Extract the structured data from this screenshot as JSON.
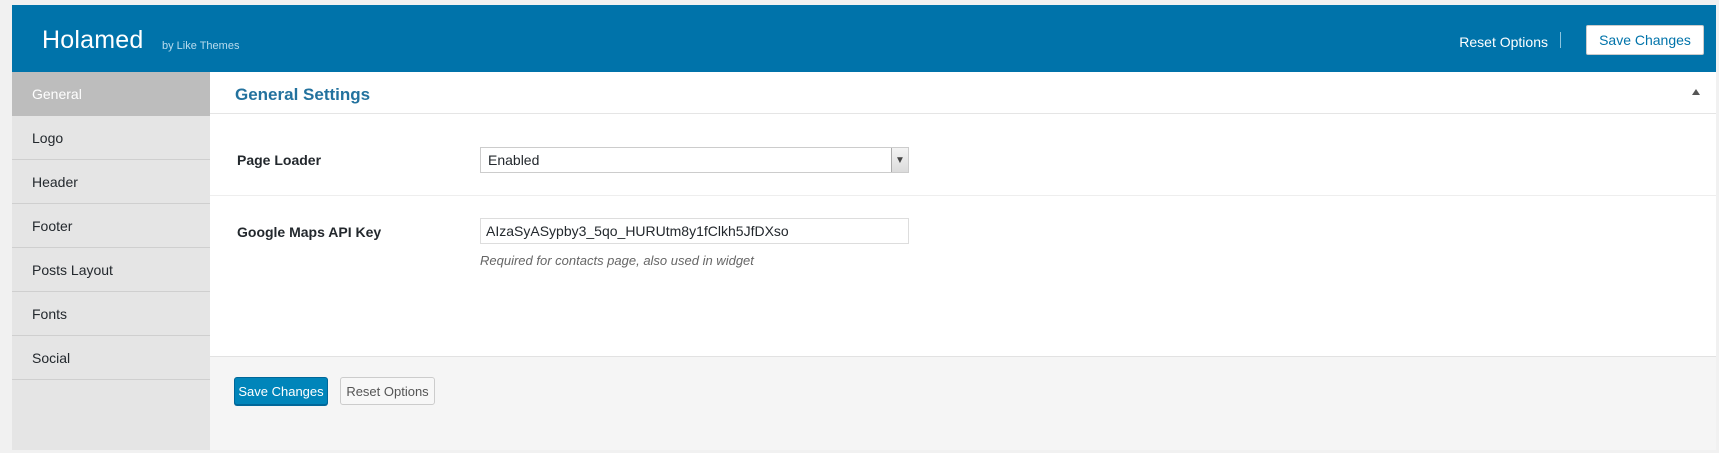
{
  "header": {
    "title": "Holamed",
    "subtitle": "by Like Themes",
    "reset_label": "Reset Options",
    "save_label": "Save Changes",
    "bg_color": "#0073aa"
  },
  "sidebar": {
    "items": [
      {
        "label": "General",
        "active": true
      },
      {
        "label": "Logo",
        "active": false
      },
      {
        "label": "Header",
        "active": false
      },
      {
        "label": "Footer",
        "active": false
      },
      {
        "label": "Posts Layout",
        "active": false
      },
      {
        "label": "Fonts",
        "active": false
      },
      {
        "label": "Social",
        "active": false
      }
    ]
  },
  "section": {
    "title": "General Settings",
    "collapse_icon": "triangle-up-icon"
  },
  "fields": {
    "page_loader": {
      "label": "Page Loader",
      "value": "Enabled"
    },
    "maps_key": {
      "label": "Google Maps API Key",
      "value": "AIzaSyASypby3_5qo_HURUtm8y1fClkh5JfDXso",
      "description": "Required for contacts page, also used in widget"
    }
  },
  "footer": {
    "save_label": "Save Changes",
    "reset_label": "Reset Options",
    "accent_color": "#0085ba"
  }
}
